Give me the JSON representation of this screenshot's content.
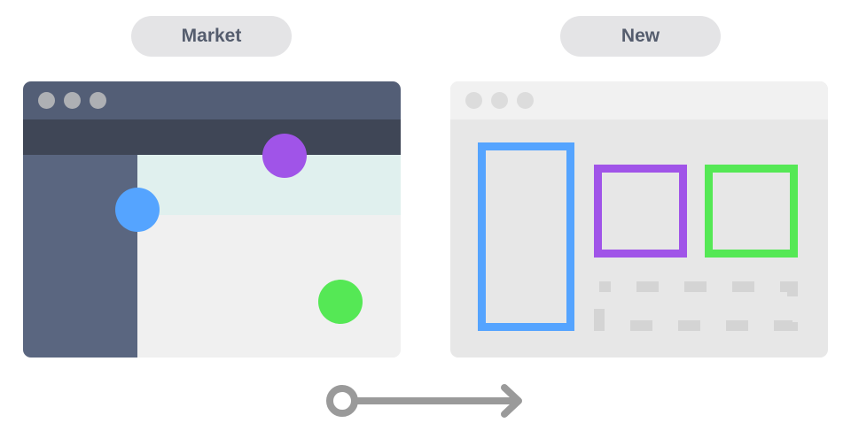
{
  "labels": {
    "left": "Market",
    "right": "New"
  },
  "colors": {
    "blue": "#55a4ff",
    "purple": "#a054e8",
    "green": "#55e855",
    "arrow": "#9a9a9a"
  }
}
